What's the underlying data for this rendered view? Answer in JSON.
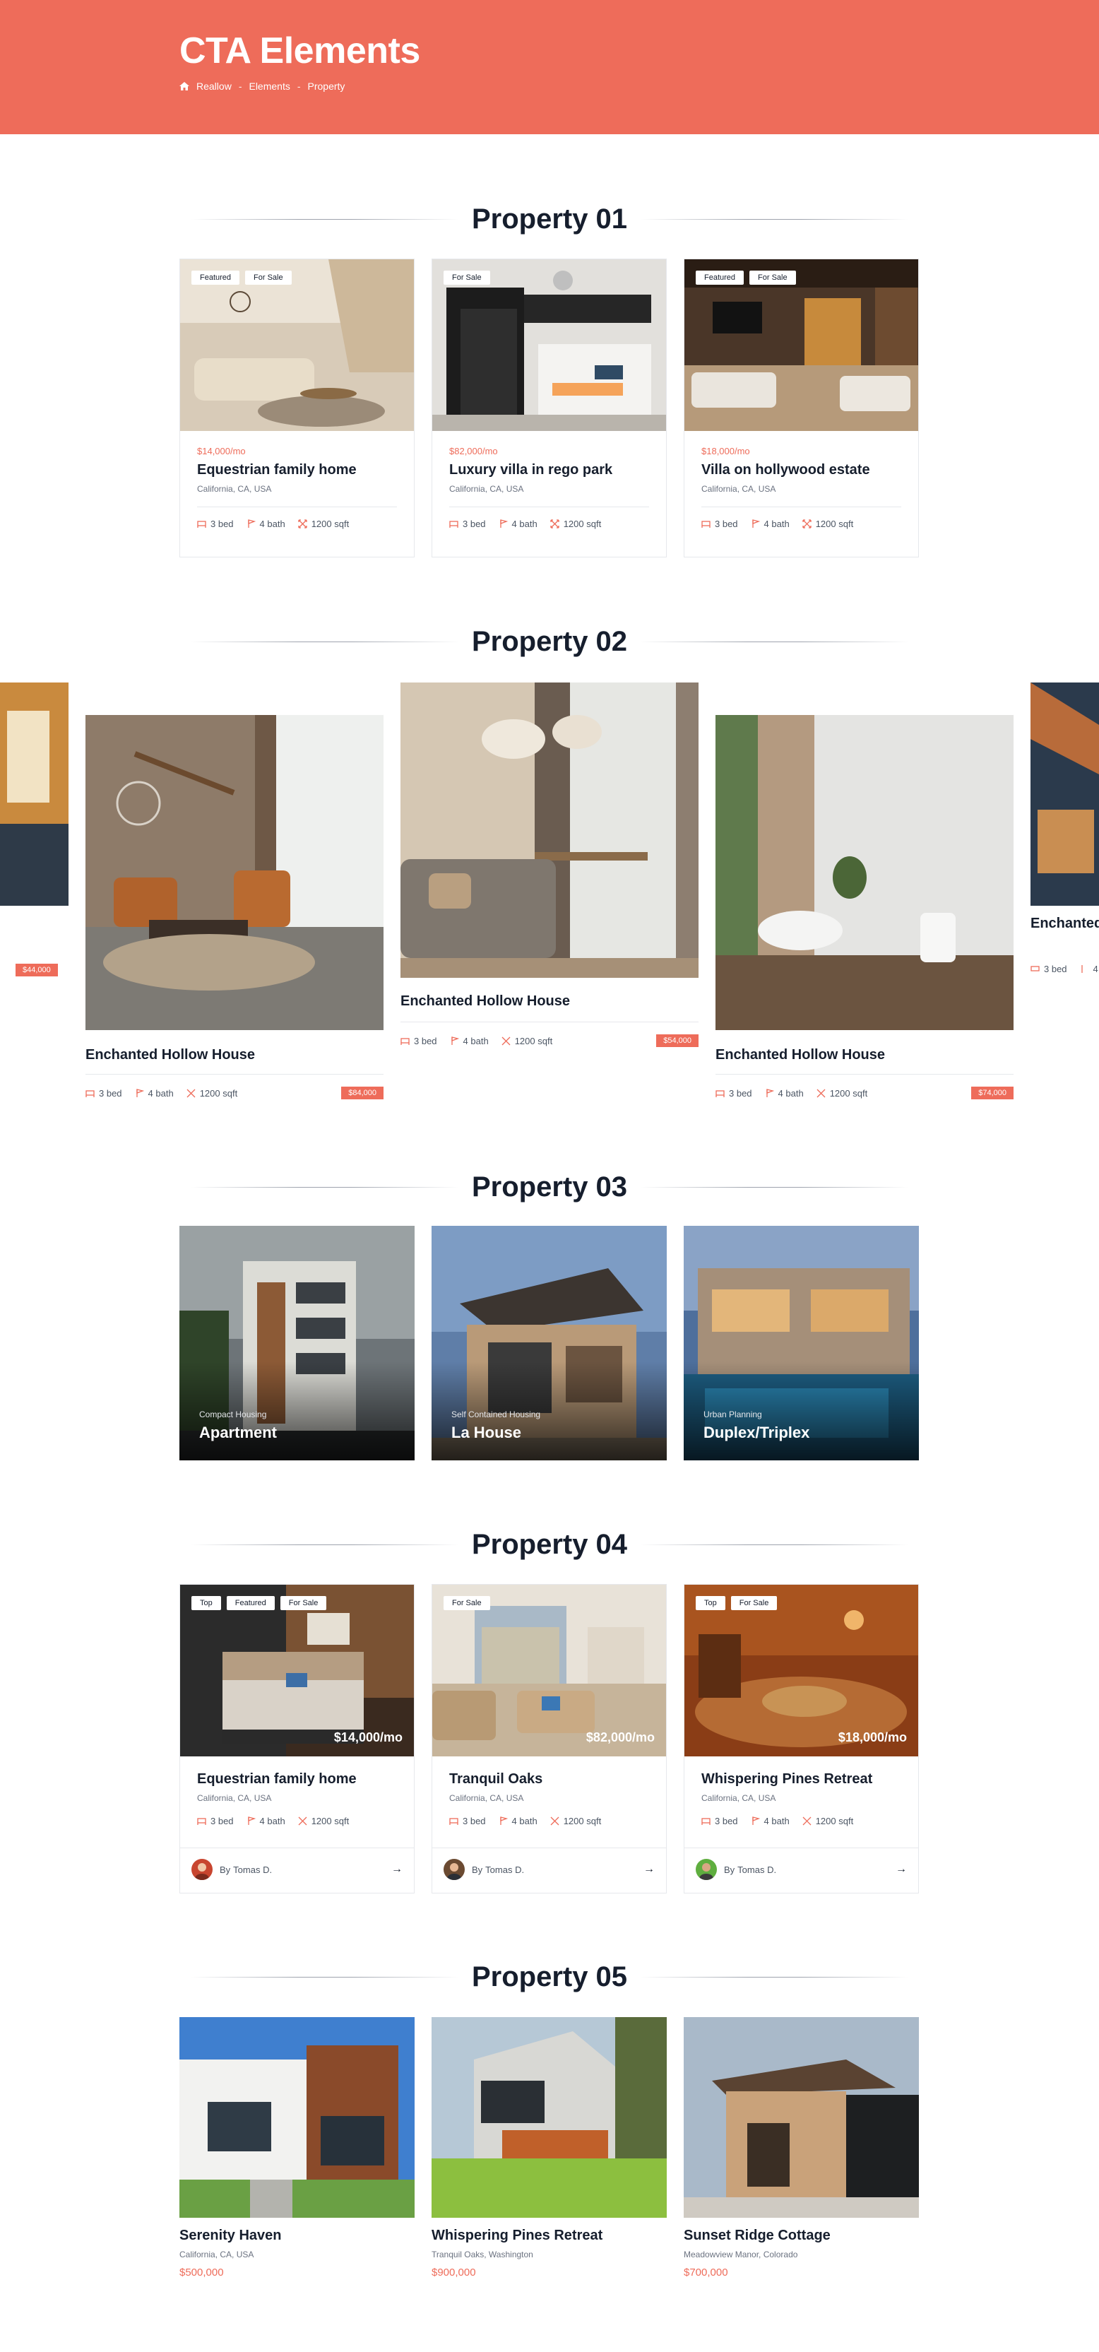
{
  "header": {
    "title": "CTA Elements",
    "breadcrumbs": [
      "Reallow",
      "Elements",
      "Property"
    ]
  },
  "colors": {
    "accent": "#ee6c5a",
    "dark": "#161e2d"
  },
  "sec1": {
    "title": "Property 01",
    "cards": [
      {
        "tags": [
          "Featured",
          "For Sale"
        ],
        "price": "$14,000/mo",
        "name": "Equestrian family home",
        "location": "California, CA, USA",
        "bed": "3 bed",
        "bath": "4 bath",
        "area": "1200 sqft"
      },
      {
        "tags": [
          "For Sale"
        ],
        "price": "$82,000/mo",
        "name": "Luxury villa in rego park",
        "location": "California, CA, USA",
        "bed": "3 bed",
        "bath": "4 bath",
        "area": "1200 sqft"
      },
      {
        "tags": [
          "Featured",
          "For Sale"
        ],
        "price": "$18,000/mo",
        "name": "Villa on hollywood estate",
        "location": "California, CA, USA",
        "bed": "3 bed",
        "bath": "4 bath",
        "area": "1200 sqft"
      }
    ]
  },
  "sec2": {
    "title": "Property 02",
    "partial_left": {
      "price": "$44,000"
    },
    "cards": [
      {
        "name": "Enchanted Hollow House",
        "bed": "3 bed",
        "bath": "4 bath",
        "area": "1200 sqft",
        "price": "$84,000"
      },
      {
        "name": "Enchanted Hollow House",
        "bed": "3 bed",
        "bath": "4 bath",
        "area": "1200 sqft",
        "price": "$54,000"
      },
      {
        "name": "Enchanted Hollow House",
        "bed": "3 bed",
        "bath": "4 bath",
        "area": "1200 sqft",
        "price": "$74,000"
      }
    ],
    "partial_right": {
      "name": "Enchanted",
      "bed": "3 bed",
      "bath": "4"
    }
  },
  "sec3": {
    "title": "Property 03",
    "cards": [
      {
        "sub": "Compact Housing",
        "name": "Apartment"
      },
      {
        "sub": "Self Contained Housing",
        "name": "La House"
      },
      {
        "sub": "Urban Planning",
        "name": "Duplex/Triplex"
      }
    ]
  },
  "sec4": {
    "title": "Property 04",
    "cards": [
      {
        "tags": [
          "Top",
          "Featured",
          "For Sale"
        ],
        "price": "$14,000/mo",
        "name": "Equestrian family home",
        "location": "California, CA, USA",
        "bed": "3 bed",
        "bath": "4 bath",
        "area": "1200 sqft",
        "by": "By",
        "agent": "Tomas D."
      },
      {
        "tags": [
          "For Sale"
        ],
        "price": "$82,000/mo",
        "name": "Tranquil Oaks",
        "location": "California, CA, USA",
        "bed": "3 bed",
        "bath": "4 bath",
        "area": "1200 sqft",
        "by": "By",
        "agent": "Tomas D."
      },
      {
        "tags": [
          "Top",
          "For Sale"
        ],
        "price": "$18,000/mo",
        "name": "Whispering Pines Retreat",
        "location": "California, CA, USA",
        "bed": "3 bed",
        "bath": "4 bath",
        "area": "1200 sqft",
        "by": "By",
        "agent": "Tomas D."
      }
    ]
  },
  "sec5": {
    "title": "Property 05",
    "cards": [
      {
        "name": "Serenity Haven",
        "location": "California, CA, USA",
        "price": "$500,000"
      },
      {
        "name": "Whispering Pines Retreat",
        "location": "Tranquil Oaks, Washington",
        "price": "$900,000"
      },
      {
        "name": "Sunset Ridge Cottage",
        "location": "Meadowview Manor, Colorado",
        "price": "$700,000"
      }
    ]
  }
}
